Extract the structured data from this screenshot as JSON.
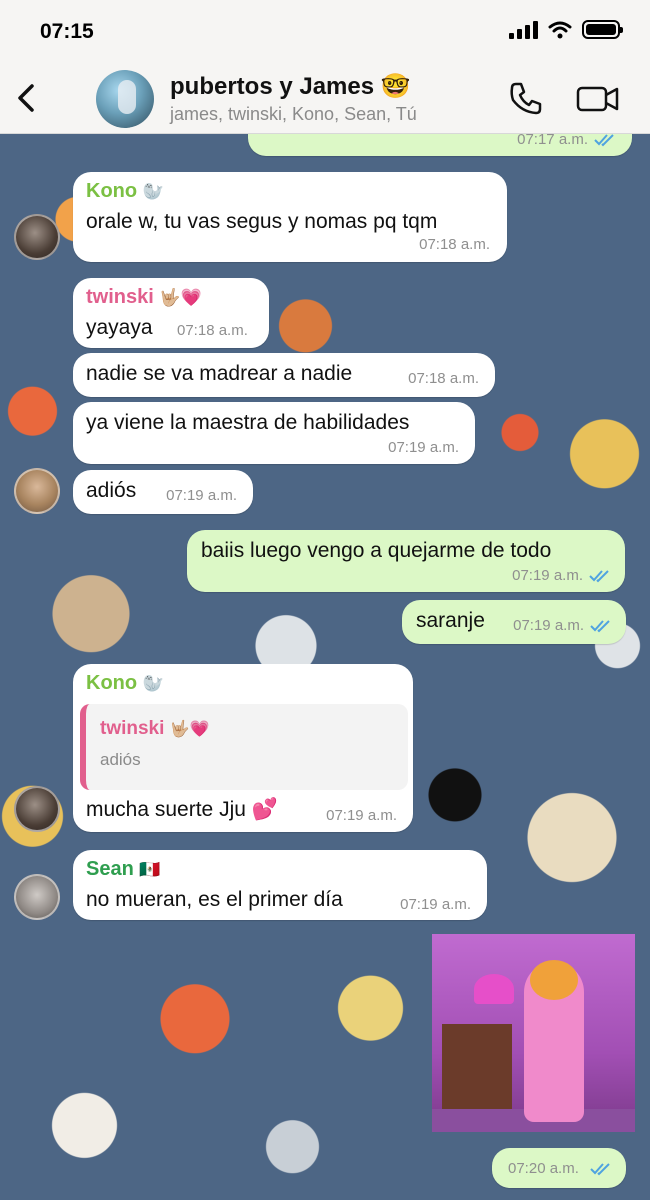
{
  "status_bar": {
    "time": "07:15"
  },
  "header": {
    "title": "pubertos y James 🤓",
    "members": "james, twinski, Kono, Sean, Tú"
  },
  "messages": [
    {
      "direction": "out",
      "time": "07:17 a.m.",
      "read": true
    },
    {
      "direction": "in",
      "sender": "Kono",
      "sender_emoji": "🦭",
      "text": "orale w, tu vas segus y nomas pq tqm",
      "time": "07:18 a.m."
    },
    {
      "direction": "in",
      "sender": "twinski",
      "sender_emoji": "🤟🏼💗",
      "text": "yayaya",
      "time": "07:18 a.m."
    },
    {
      "direction": "in",
      "text": "nadie se va madrear a nadie",
      "time": "07:18 a.m."
    },
    {
      "direction": "in",
      "text": "ya viene la maestra de habilidades",
      "time": "07:19 a.m."
    },
    {
      "direction": "in",
      "text": "adiós",
      "time": "07:19 a.m."
    },
    {
      "direction": "out",
      "text": "baiis luego vengo a quejarme de todo",
      "time": "07:19 a.m.",
      "read": true
    },
    {
      "direction": "out",
      "text": "saranje",
      "time": "07:19 a.m.",
      "read": true
    },
    {
      "direction": "in",
      "sender": "Kono",
      "sender_emoji": "🦭",
      "quote": {
        "sender": "twinski",
        "sender_emoji": "🤟🏼💗",
        "text": "adiós"
      },
      "text": "mucha suerte Jju 💕",
      "time": "07:19 a.m."
    },
    {
      "direction": "in",
      "sender": "Sean",
      "sender_emoji": "🇲🇽",
      "text": "no mueran, es el primer día",
      "time": "07:19 a.m."
    },
    {
      "direction": "out",
      "type": "image",
      "time": "07:20 a.m.",
      "read": true
    }
  ],
  "colors": {
    "incoming_bubble": "#ffffff",
    "outgoing_bubble": "#dcf8c6",
    "kono": "#7bc043",
    "twinski": "#e15f8d",
    "sean": "#2f9e4f",
    "read_ticks": "#4fa3e0"
  },
  "icons": [
    "back-arrow-icon",
    "phone-icon",
    "video-camera-icon",
    "signal-icon",
    "wifi-icon",
    "battery-icon",
    "double-check-icon"
  ]
}
